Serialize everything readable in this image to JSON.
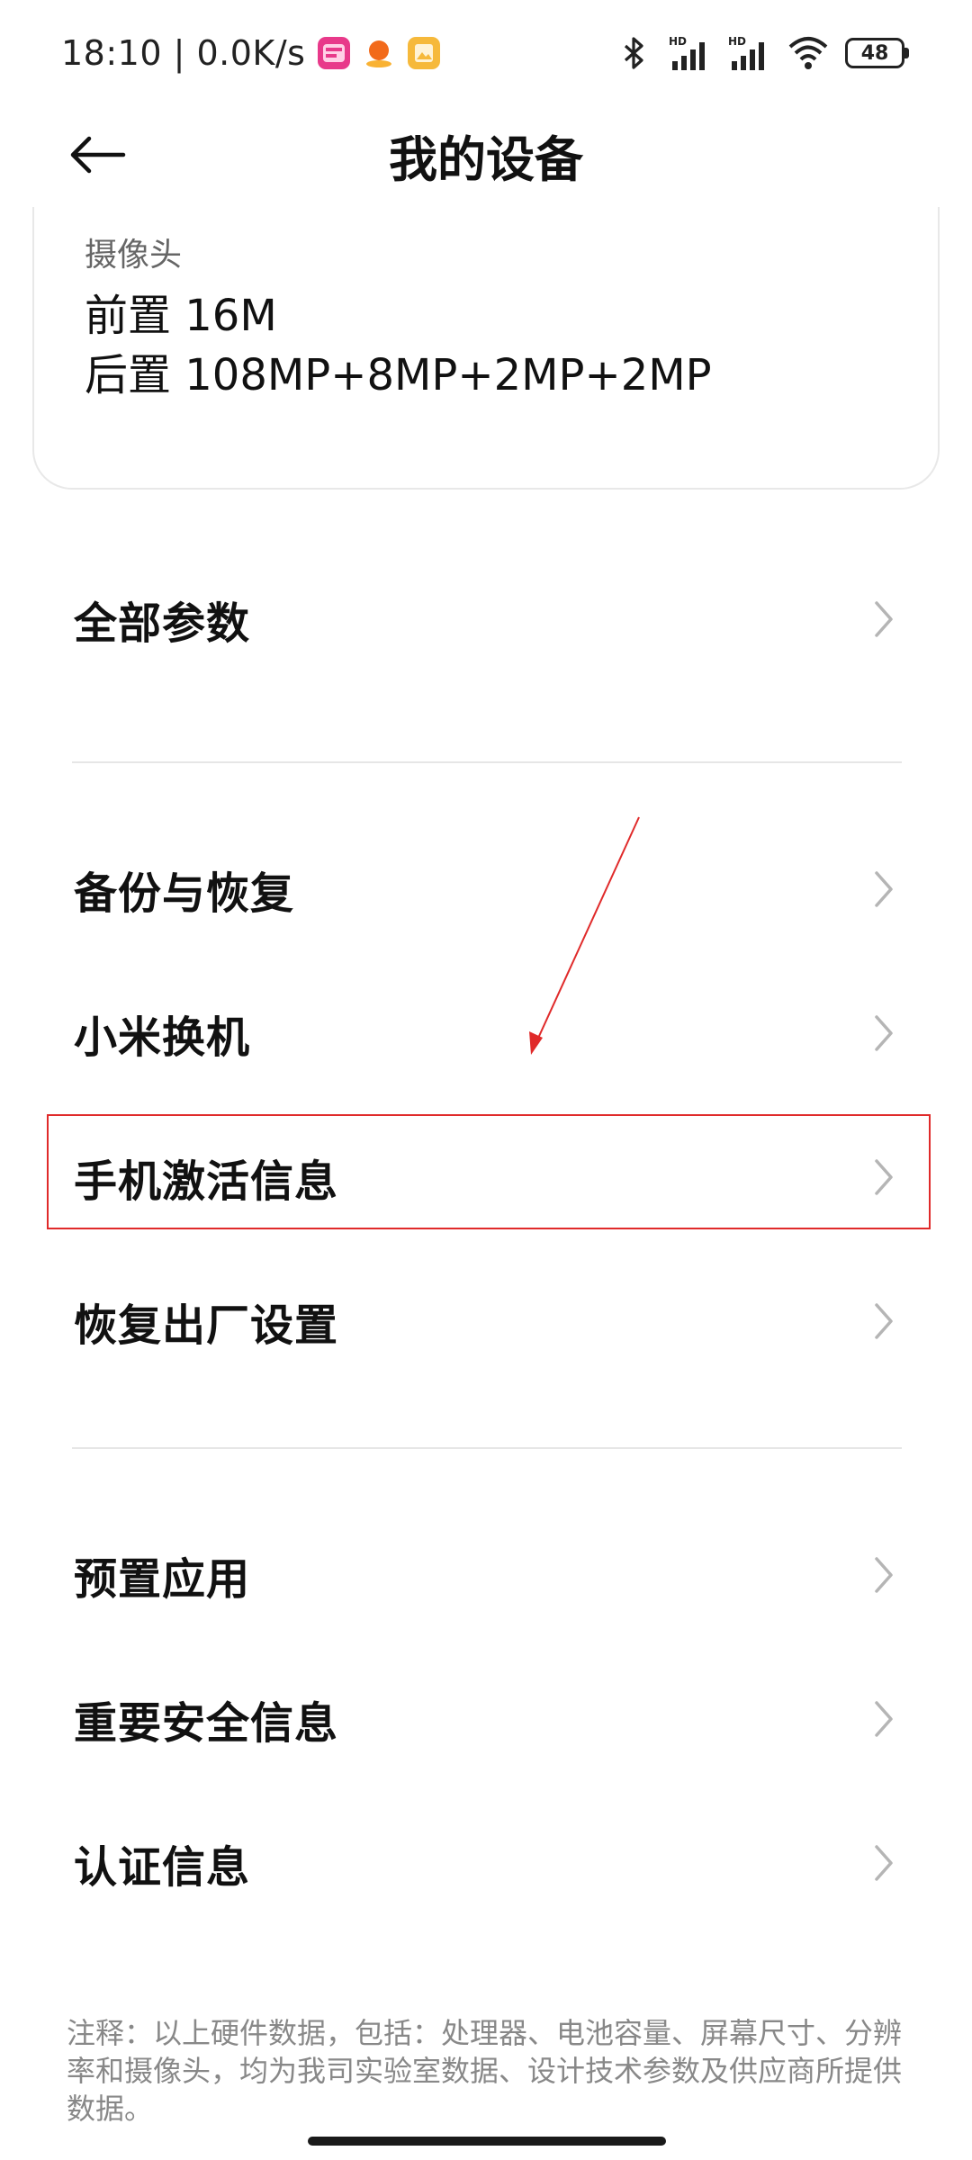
{
  "status_bar": {
    "time_speed": "18:10 | 0.0K/s",
    "app_icons": [
      "promo-app-icon",
      "orange-app-icon",
      "gallery-app-icon"
    ],
    "battery": "48",
    "signal_labels": [
      "HD",
      "HD"
    ]
  },
  "header": {
    "title": "我的设备"
  },
  "camera_card": {
    "label": "摄像头",
    "front": "前置 16M",
    "rear": "后置 108MP+8MP+2MP+2MP"
  },
  "list": {
    "all_params": "全部参数",
    "backup_restore": "备份与恢复",
    "mi_mover": "小米换机",
    "activation_info": "手机激活信息",
    "factory_reset": "恢复出厂设置",
    "preinstalled_apps": "预置应用",
    "safety_info": "重要安全信息",
    "certification": "认证信息"
  },
  "note": "注释：以上硬件数据，包括：处理器、电池容量、屏幕尺寸、分辨率和摄像头，均为我司实验室数据、设计技术参数及供应商所提供数据。",
  "colors": {
    "highlight": "#e02a2a",
    "text": "#111111",
    "muted": "#888888"
  }
}
